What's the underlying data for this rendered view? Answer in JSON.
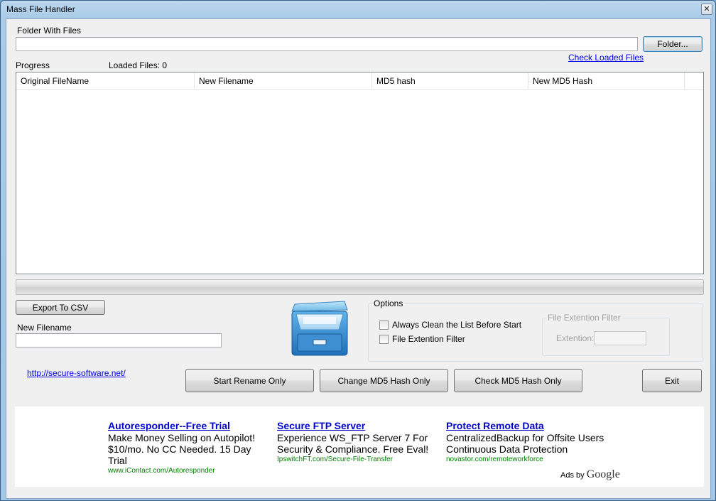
{
  "window": {
    "title": "Mass File Handler",
    "close_glyph": "✕"
  },
  "folder": {
    "label": "Folder With Files",
    "value": "",
    "button_label": "Folder..."
  },
  "check_loaded_link": "Check Loaded Files",
  "progress_label": "Progress",
  "loaded_files": "Loaded Files: 0",
  "table": {
    "columns": [
      "Original FileName",
      "New Filename",
      "MD5 hash",
      "New MD5 Hash"
    ],
    "rows": []
  },
  "export_button": "Export To CSV",
  "new_filename": {
    "label": "New Filename",
    "value": ""
  },
  "file_cabinet_icon": "file-cabinet-icon",
  "options": {
    "caption": "Options",
    "always_clean": {
      "label": "Always Clean the List Before Start",
      "checked": false
    },
    "file_ext_filter": {
      "label": "File Extention Filter",
      "checked": false
    },
    "filter_group": {
      "caption": "File Extention Filter",
      "extention_label": "Extention:",
      "extention_value": ""
    }
  },
  "website_link": "http://secure-software.net/",
  "buttons": {
    "start_rename": "Start Rename Only",
    "change_md5": "Change MD5 Hash Only",
    "check_md5": "Check MD5 Hash Only",
    "exit": "Exit"
  },
  "ads": [
    {
      "title": "Autoresponder--Free Trial",
      "body": "Make Money Selling on Autopilot! $10/mo. No CC Needed. 15 Day Trial",
      "url": "www.iContact.com/Autoresponder"
    },
    {
      "title": "Secure FTP Server",
      "body": "Experience WS_FTP Server 7 For Security & Compliance. Free Eval!",
      "url": "IpswitchFT.com/Secure-File-Transfer"
    },
    {
      "title": "Protect Remote Data",
      "body": "CentralizedBackup for Offsite Users Continuous Data Protection",
      "url": "novastor.com/remoteworkforce"
    }
  ],
  "ads_by": {
    "text": "Ads by",
    "brand": "Google"
  },
  "colors": {
    "accent_link": "#0000ee",
    "ad_title": "#0000cc",
    "ad_url": "#008000",
    "titlebar": "#bcd7ee"
  }
}
